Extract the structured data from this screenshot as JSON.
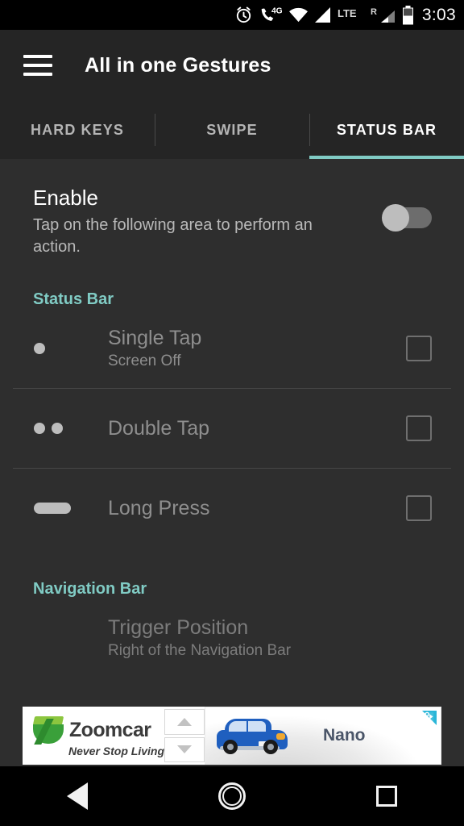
{
  "system_status_bar": {
    "time": "3:03",
    "icons": [
      "alarm-icon",
      "call-4g-icon",
      "wifi-icon",
      "signal-bars-icon",
      "lte-label",
      "roaming-label",
      "signal-bars-2-icon",
      "battery-icon"
    ],
    "lte_label": "LTE",
    "roaming_label": "R",
    "network_label": "4G"
  },
  "app_bar": {
    "title": "All in one Gestures",
    "menu_icon": "hamburger-menu-icon"
  },
  "tabs": [
    {
      "label": "HARD KEYS",
      "active": false
    },
    {
      "label": "SWIPE",
      "active": false
    },
    {
      "label": "STATUS BAR",
      "active": true
    }
  ],
  "enable": {
    "title": "Enable",
    "description": "Tap on the following area to perform an action.",
    "toggle_state": "off"
  },
  "sections": [
    {
      "heading": "Status Bar",
      "rows": [
        {
          "icon": "single-dot-icon",
          "title": "Single Tap",
          "subtitle": "Screen Off",
          "checked": false
        },
        {
          "icon": "double-dot-icon",
          "title": "Double Tap",
          "subtitle": "",
          "checked": false
        },
        {
          "icon": "long-press-pill-icon",
          "title": "Long Press",
          "subtitle": "",
          "checked": false
        }
      ]
    },
    {
      "heading": "Navigation Bar",
      "rows": [
        {
          "icon": "",
          "title": "Trigger Position",
          "subtitle": "Right of the Navigation Bar",
          "checked": null
        }
      ]
    }
  ],
  "ad": {
    "brand": "Zoomcar",
    "tagline": "Never Stop Living",
    "product": "Nano",
    "adchoices_icon": "adchoices-icon",
    "scroll_up_icon": "arrow-up-icon",
    "scroll_down_icon": "arrow-down-icon"
  },
  "nav_bar": {
    "back_icon": "back-triangle-icon",
    "home_icon": "home-circle-icon",
    "recents_icon": "recents-square-icon"
  },
  "colors": {
    "accent": "#80cbc4",
    "app_bar": "#252525",
    "background": "#2e2e2e"
  }
}
